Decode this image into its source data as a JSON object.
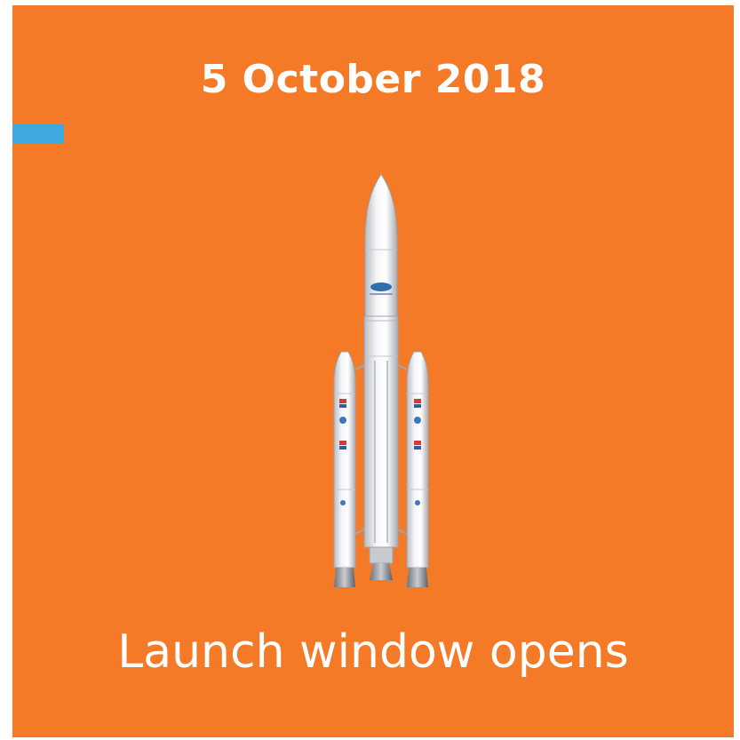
{
  "poster": {
    "date": "5 October 2018",
    "caption": "Launch window opens",
    "background_color": "#f47a27",
    "accent_color": "#3fa9df"
  },
  "rocket": {
    "icon": "rocket-launcher-icon"
  }
}
